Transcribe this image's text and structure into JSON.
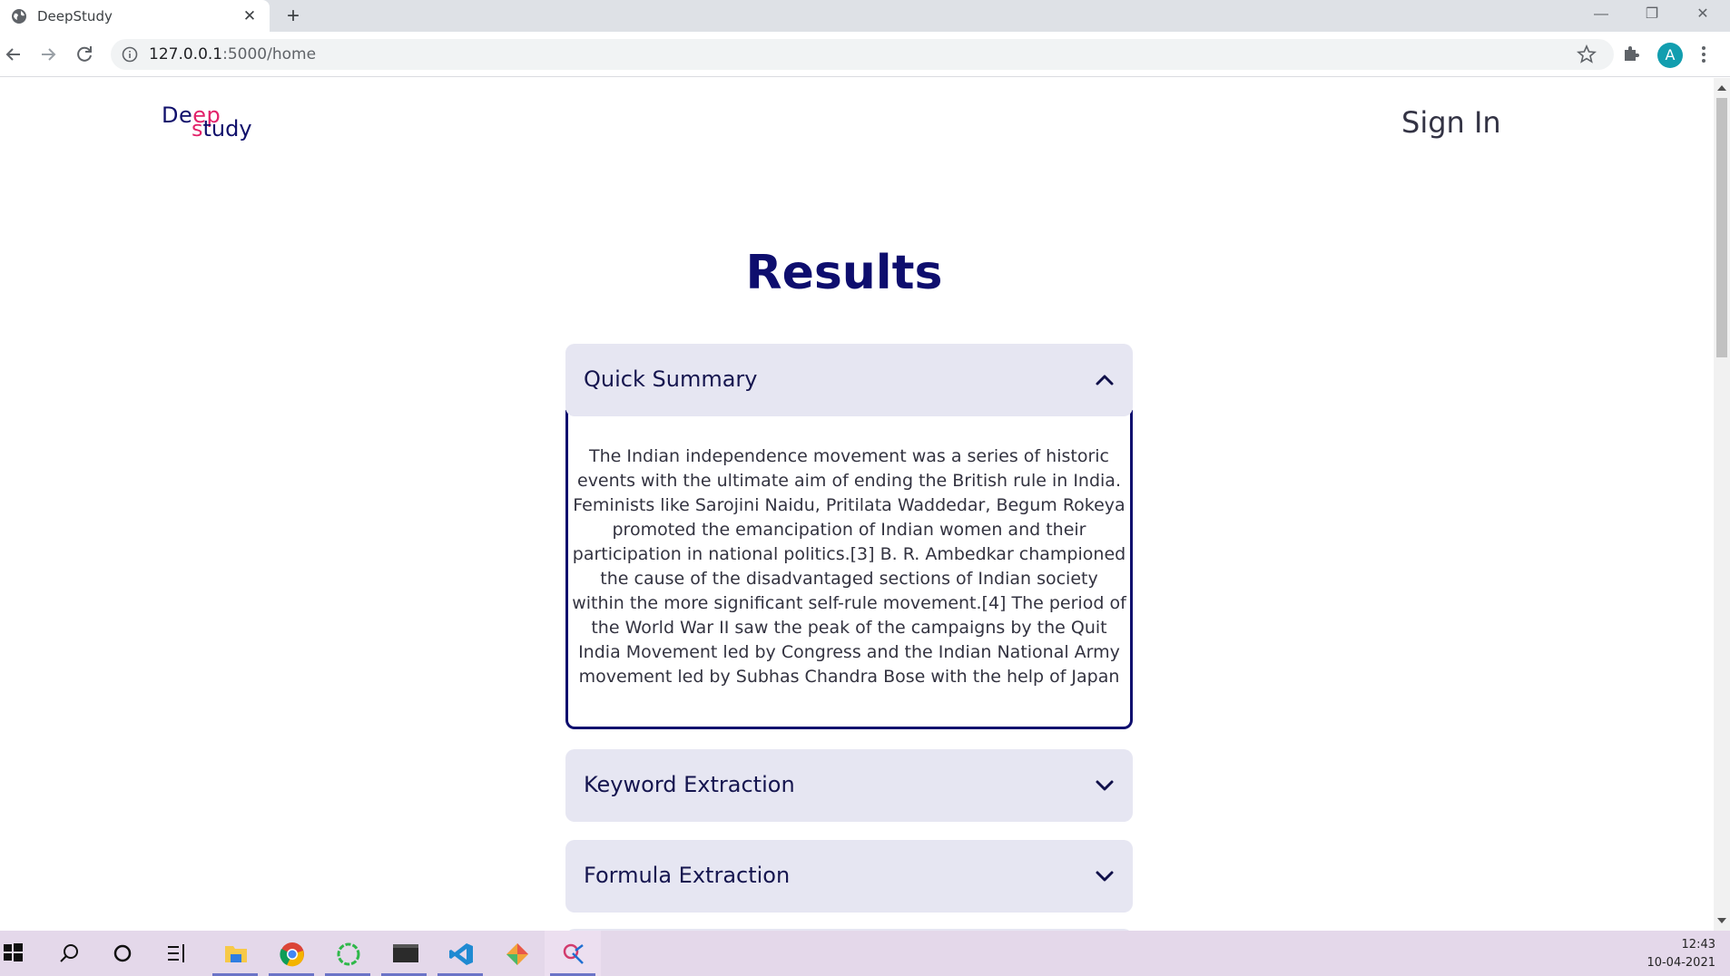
{
  "browser": {
    "tab_title": "DeepStudy",
    "url_host": "127.0.0.1",
    "url_path": ":5000/home",
    "profile_initial": "A",
    "icons": [
      "globe-icon",
      "close-icon",
      "plus-icon",
      "back-icon",
      "forward-icon",
      "reload-icon",
      "info-icon",
      "star-icon",
      "puzzle-icon",
      "kebab-menu-icon"
    ]
  },
  "header": {
    "logo_line1_a": "De",
    "logo_line1_b": "ep",
    "logo_line2_a": "s",
    "logo_line2_b": "tudy",
    "signin_label": "Sign In"
  },
  "main": {
    "title": "Results",
    "sections": [
      {
        "label": "Quick Summary",
        "expanded": true,
        "content": "The Indian independence movement was a series of historic events with the ultimate aim of ending the British rule in India. Feminists like Sarojini Naidu, Pritilata Waddedar, Begum Rokeya promoted the emancipation of Indian women and their participation in national politics.[3] B. R. Ambedkar championed the cause of the disadvantaged sections of Indian society within the more significant self-rule movement.[4] The period of the World War II saw the peak of the campaigns by the Quit India Movement led by Congress and the Indian National Army movement led by Subhas Chandra Bose with the help of Japan"
      },
      {
        "label": "Keyword Extraction",
        "expanded": false
      },
      {
        "label": "Formula Extraction",
        "expanded": false
      }
    ]
  },
  "taskbar": {
    "time": "12:43",
    "date": "10-04-2021"
  },
  "colors": {
    "brand_navy": "#0e0e6e",
    "brand_pink": "#e2226a",
    "accordion_bg": "#e6e6f2"
  }
}
